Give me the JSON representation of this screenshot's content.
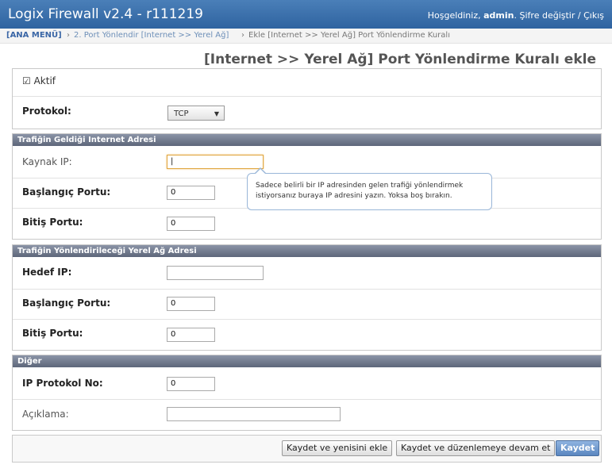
{
  "header": {
    "app_title": "Logix Firewall v2.4 - r111219",
    "welcome_prefix": "Hoşgeldiniz,",
    "username": "admin",
    "password_link": "Şifre değiştir",
    "separator": "/",
    "logout_link": "Çıkış"
  },
  "breadcrumb": {
    "home": "[ANA MENÜ]",
    "sep": "›",
    "step2": "2. Port Yönlendir [Internet >> Yerel Ağ]",
    "current": "Ekle [Internet >> Yerel Ağ] Port Yönlendirme Kuralı"
  },
  "page_title": "[Internet >> Yerel Ağ] Port Yönlendirme Kuralı ekle",
  "general": {
    "active_label": "Aktif",
    "active_checked": true,
    "protocol_label": "Protokol:",
    "protocol_value": "TCP"
  },
  "source": {
    "heading": "Trafiğin Geldiği Internet Adresi",
    "ip_label": "Kaynak IP:",
    "ip_value": "",
    "start_port_label": "Başlangıç Portu:",
    "start_port_value": "0",
    "end_port_label": "Bitiş Portu:",
    "end_port_value": "0"
  },
  "tooltip": {
    "text": "Sadece belirli bir IP adresinden gelen trafiği yönlendirmek istiyorsanız buraya IP adresini yazın. Yoksa boş bırakın."
  },
  "destination": {
    "heading": "Trafiğin Yönlendirileceği Yerel Ağ Adresi",
    "ip_label": "Hedef IP:",
    "ip_value": "",
    "start_port_label": "Başlangıç Portu:",
    "start_port_value": "0",
    "end_port_label": "Bitiş Portu:",
    "end_port_value": "0"
  },
  "other": {
    "heading": "Diğer",
    "ip_proto_label": "IP Protokol No:",
    "ip_proto_value": "0",
    "desc_label": "Açıklama:",
    "desc_value": ""
  },
  "buttons": {
    "save_add": "Kaydet ve yenisini ekle",
    "save_continue": "Kaydet ve düzenlemeye devam et",
    "save": "Kaydet"
  },
  "colors": {
    "header_bg": "#2f63a0",
    "section_head_bg": "#5d667a",
    "primary_button": "#5a86c0"
  }
}
